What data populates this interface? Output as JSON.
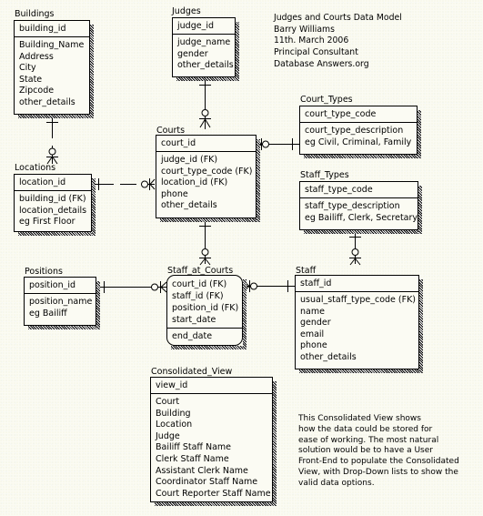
{
  "header": {
    "lines": [
      "Judges and Courts Data Model",
      "Barry Williams",
      "11th. March 2006",
      "Principal Consultant",
      "Database Answers.org"
    ]
  },
  "entities": {
    "buildings": {
      "name": "Buildings",
      "pk": [
        "building_id"
      ],
      "attributes": [
        "Building_Name",
        "Address",
        "City",
        "State",
        "Zipcode",
        "other_details"
      ]
    },
    "judges": {
      "name": "Judges",
      "pk": [
        "judge_id"
      ],
      "attributes": [
        "judge_name",
        "gender",
        "other_details"
      ]
    },
    "court_types": {
      "name": "Court_Types",
      "pk": [
        "court_type_code"
      ],
      "attributes": [
        "court_type_description",
        "eg Civil, Criminal, Family"
      ]
    },
    "locations": {
      "name": "Locations",
      "pk": [
        "location_id"
      ],
      "attributes": [
        "building_id (FK)",
        "location_details",
        "eg First Floor"
      ]
    },
    "courts": {
      "name": "Courts",
      "pk": [
        "court_id"
      ],
      "attributes": [
        "judge_id (FK)",
        "court_type_code (FK)",
        "location_id (FK)",
        "phone",
        "other_details"
      ]
    },
    "staff_types": {
      "name": "Staff_Types",
      "pk": [
        "staff_type_code"
      ],
      "attributes": [
        "staff_type_description",
        "eg Bailiff, Clerk, Secretary"
      ]
    },
    "positions": {
      "name": "Positions",
      "pk": [
        "position_id"
      ],
      "attributes": [
        "position_name",
        "eg Bailiff"
      ]
    },
    "staff_at_courts": {
      "name": "Staff_at_Courts",
      "pk": [
        "court_id (FK)",
        "staff_id (FK)",
        "position_id (FK)",
        "start_date"
      ],
      "attributes": [
        "end_date"
      ]
    },
    "staff": {
      "name": "Staff",
      "pk": [
        "staff_id"
      ],
      "attributes": [
        "usual_staff_type_code (FK)",
        "name",
        "gender",
        "email",
        "phone",
        "other_details"
      ]
    },
    "consolidated_view": {
      "name": "Consolidated_View",
      "pk": [
        "view_id"
      ],
      "attributes": [
        "Court",
        "Building",
        "Location",
        "Judge",
        "Bailiff Staff Name",
        "Clerk Staff Name",
        "Assistant Clerk Name",
        "Coordinator Staff Name",
        "Court Reporter Staff Name"
      ]
    }
  },
  "relationships": [
    {
      "from": "Buildings",
      "to": "Locations",
      "style": "dashed",
      "parent": "one",
      "child": "zero-or-many"
    },
    {
      "from": "Judges",
      "to": "Courts",
      "style": "solid",
      "parent": "one",
      "child": "zero-or-many"
    },
    {
      "from": "Court_Types",
      "to": "Courts",
      "style": "solid",
      "parent": "one",
      "child": "zero-or-many"
    },
    {
      "from": "Locations",
      "to": "Courts",
      "style": "dashed",
      "parent": "one",
      "child": "zero-or-many"
    },
    {
      "from": "Courts",
      "to": "Staff_at_Courts",
      "style": "solid",
      "parent": "one",
      "child": "zero-or-many"
    },
    {
      "from": "Positions",
      "to": "Staff_at_Courts",
      "style": "solid",
      "parent": "one",
      "child": "zero-or-many"
    },
    {
      "from": "Staff",
      "to": "Staff_at_Courts",
      "style": "solid",
      "parent": "one",
      "child": "zero-or-many"
    },
    {
      "from": "Staff_Types",
      "to": "Staff",
      "style": "solid",
      "parent": "one",
      "child": "zero-or-many"
    }
  ],
  "note": {
    "lines": [
      "This Consolidated View shows",
      "how the data could be stored for",
      "ease of working. The most natural",
      "solution would be to have a User",
      "Front-End to populate the Consolidated",
      "View, with Drop-Down lists to show the",
      "valid data options."
    ]
  }
}
